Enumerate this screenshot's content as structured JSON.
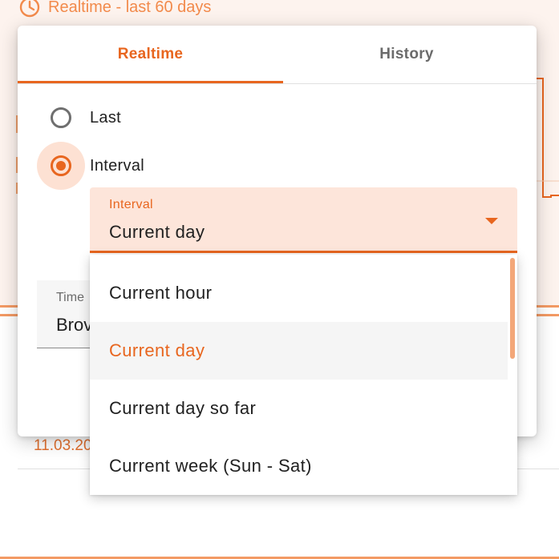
{
  "background": {
    "header_text": "Realtime - last 60 days",
    "date_text": "11.03.20",
    "accent_color": "#e8661f"
  },
  "dialog": {
    "tabs": [
      {
        "label": "Realtime",
        "active": true
      },
      {
        "label": "History",
        "active": false
      }
    ],
    "radio_last": {
      "label": "Last",
      "checked": false
    },
    "radio_interval": {
      "label": "Interval",
      "checked": true
    },
    "interval_select": {
      "label": "Interval",
      "value": "Current day"
    },
    "timezone_field": {
      "label": "Time",
      "value": "Brov"
    }
  },
  "menu": {
    "options": [
      {
        "label": "Current hour",
        "selected": false
      },
      {
        "label": "Current day",
        "selected": true
      },
      {
        "label": "Current day so far",
        "selected": false
      },
      {
        "label": "Current week (Sun - Sat)",
        "selected": false
      }
    ]
  }
}
